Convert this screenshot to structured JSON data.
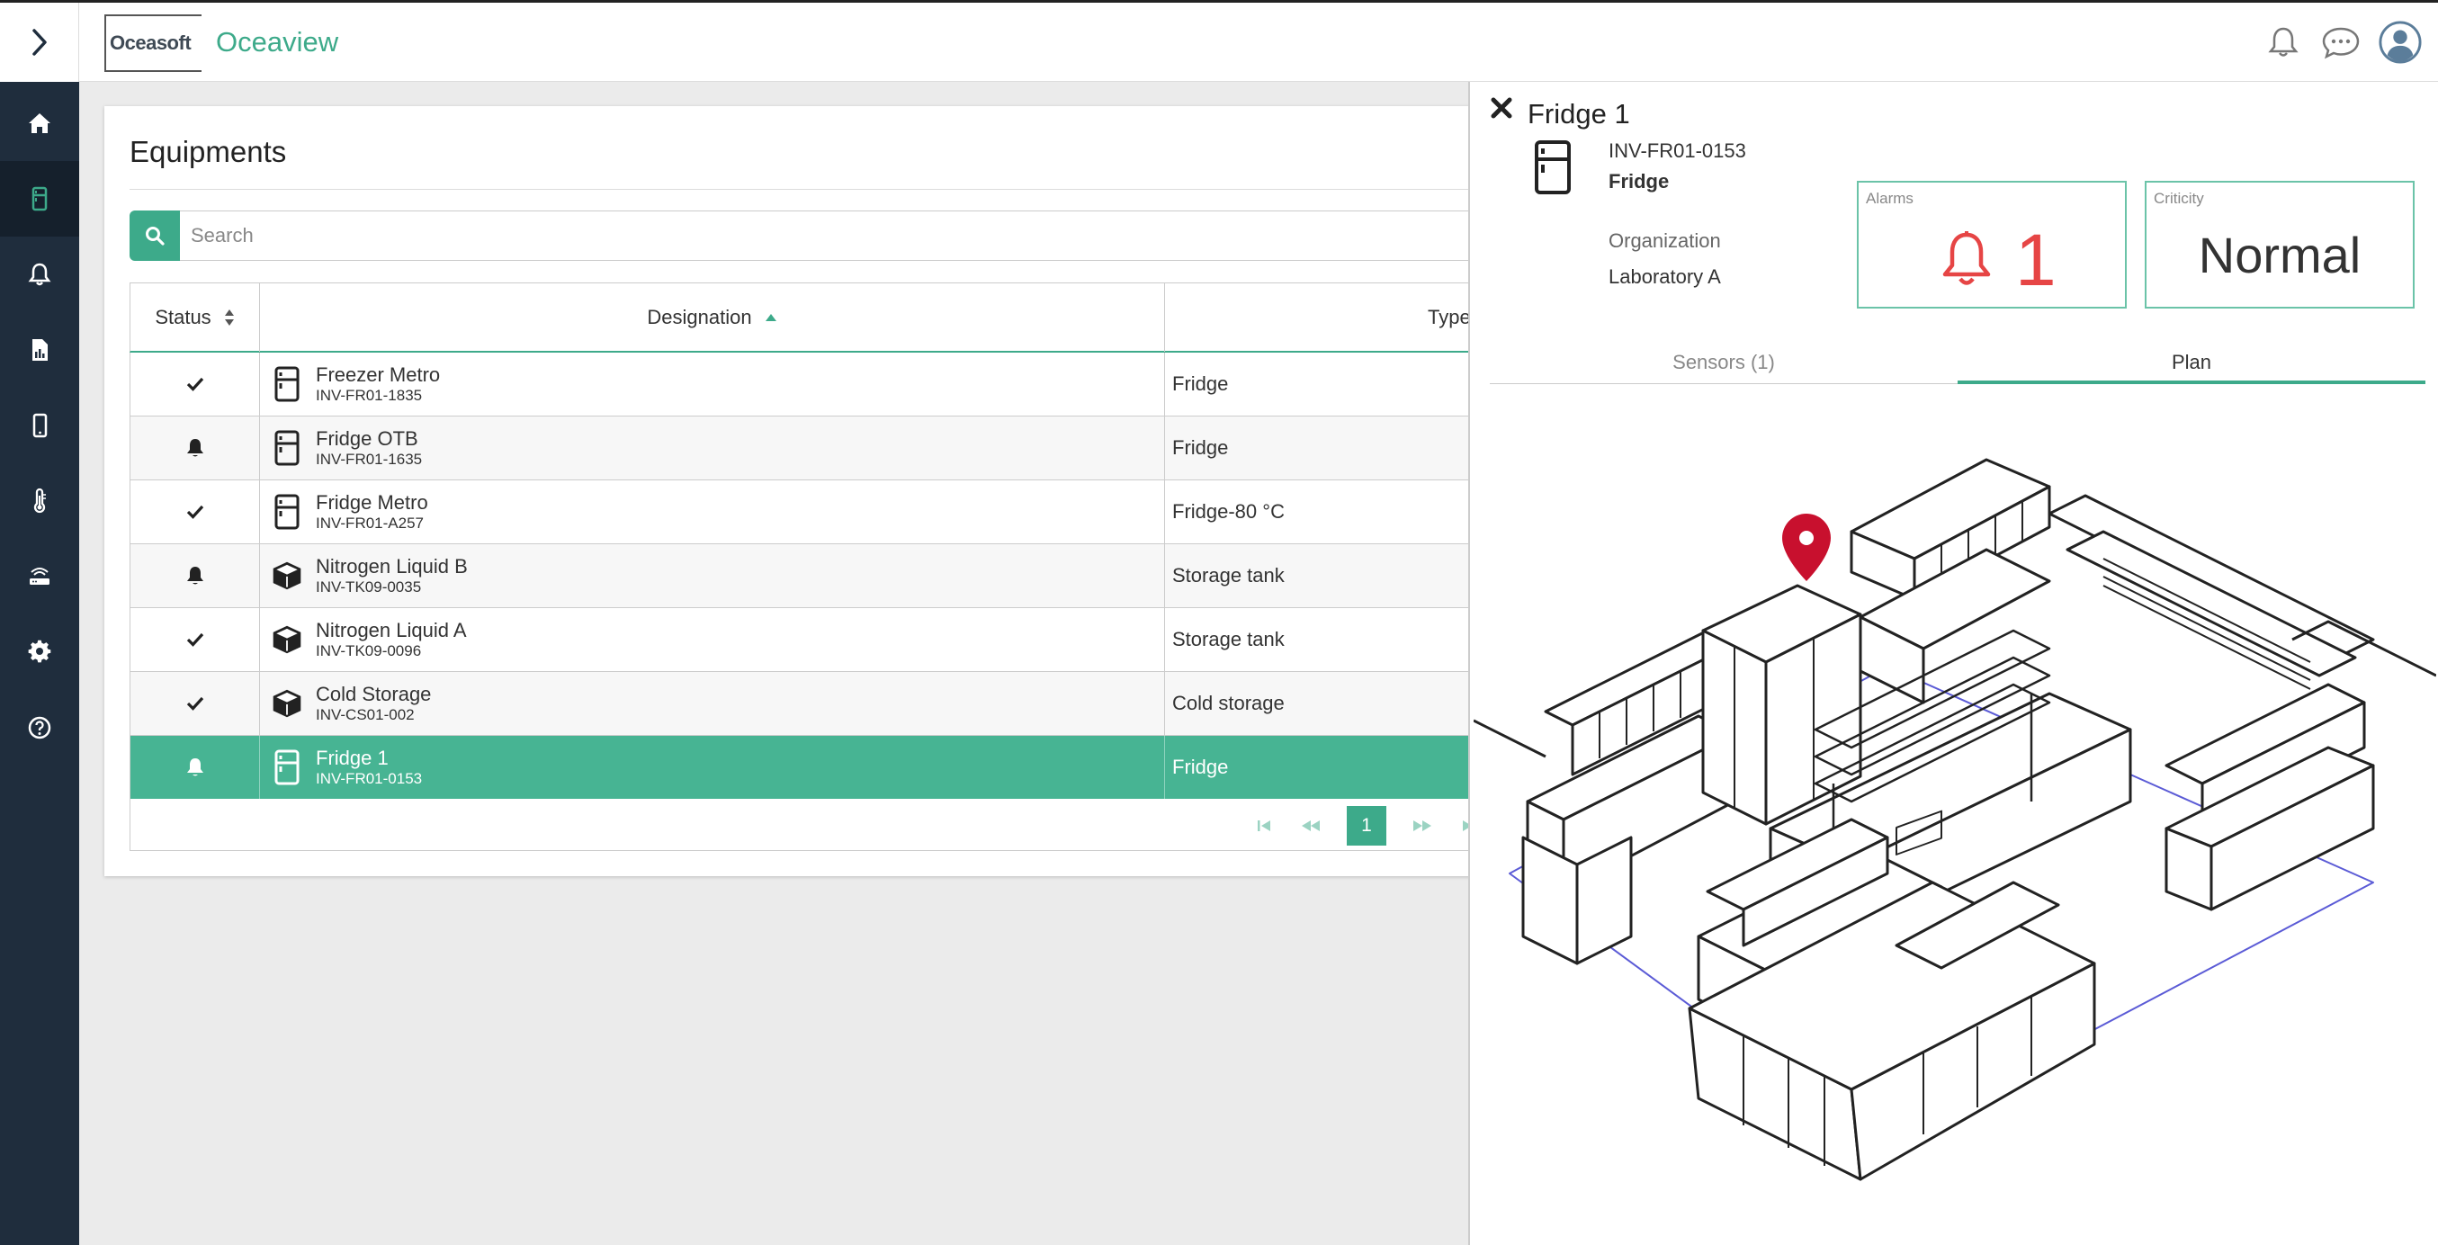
{
  "app": {
    "logo": "Oceasoft",
    "name": "Oceaview"
  },
  "sidebar": {
    "items": [
      {
        "icon": "home-icon"
      },
      {
        "icon": "fridge-icon",
        "active": true
      },
      {
        "icon": "bell-icon"
      },
      {
        "icon": "report-icon"
      },
      {
        "icon": "mobile-icon"
      },
      {
        "icon": "thermometer-icon"
      },
      {
        "icon": "router-icon"
      },
      {
        "icon": "gear-icon"
      },
      {
        "icon": "help-icon"
      }
    ]
  },
  "page": {
    "title": "Equipments",
    "search_placeholder": "Search",
    "columns": {
      "status": "Status",
      "designation": "Designation",
      "type": "Type"
    },
    "rows": [
      {
        "status": "check",
        "icon": "fridge",
        "name": "Freezer Metro",
        "code": "INV-FR01-1835",
        "type": "Fridge"
      },
      {
        "status": "alarm",
        "icon": "fridge",
        "name": "Fridge OTB",
        "code": "INV-FR01-1635",
        "type": "Fridge"
      },
      {
        "status": "check",
        "icon": "fridge",
        "name": "Fridge Metro",
        "code": "INV-FR01-A257",
        "type": "Fridge-80 °C"
      },
      {
        "status": "alarm",
        "icon": "cube",
        "name": "Nitrogen Liquid B",
        "code": "INV-TK09-0035",
        "type": "Storage tank"
      },
      {
        "status": "check",
        "icon": "cube",
        "name": "Nitrogen Liquid A",
        "code": "INV-TK09-0096",
        "type": "Storage tank"
      },
      {
        "status": "check",
        "icon": "cube",
        "name": "Cold Storage",
        "code": "INV-CS01-002",
        "type": "Cold storage"
      },
      {
        "status": "alarm",
        "icon": "fridge",
        "name": "Fridge 1",
        "code": "INV-FR01-0153",
        "type": "Fridge",
        "selected": true
      }
    ],
    "pager": {
      "current": "1"
    }
  },
  "detail": {
    "title": "Fridge 1",
    "code": "INV-FR01-0153",
    "type": "Fridge",
    "org_label": "Organization",
    "org": "Laboratory A",
    "alarms_label": "Alarms",
    "alarms": "1",
    "criticity_label": "Criticity",
    "criticity": "Normal",
    "tabs": [
      "Sensors (1)",
      "Plan"
    ],
    "active_tab": "Plan"
  },
  "colors": {
    "accent": "#3daa8a",
    "sidebar": "#1f2d3d",
    "alarm": "#e64545",
    "pin": "#c8102e"
  }
}
